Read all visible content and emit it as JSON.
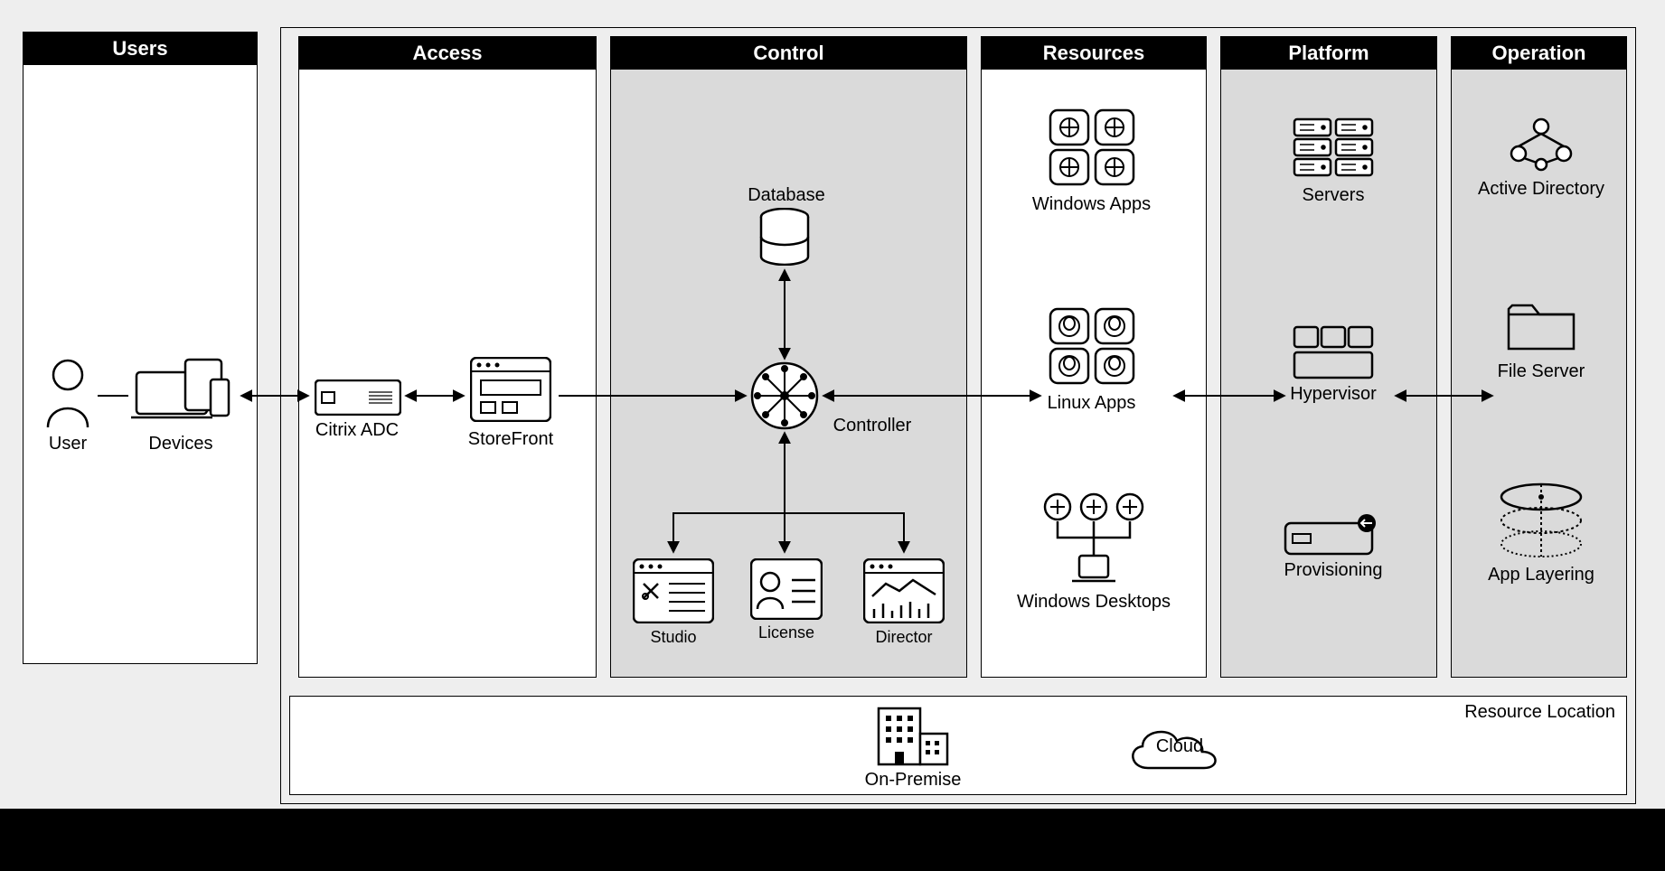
{
  "layers": {
    "users": "Users",
    "access": "Access",
    "control": "Control",
    "resources": "Resources",
    "platform": "Platform",
    "operation": "Operation"
  },
  "nodes": {
    "user": "User",
    "devices": "Devices",
    "citrix_adc": "Citrix ADC",
    "storefront": "StoreFront",
    "database": "Database",
    "controller": "Controller",
    "studio": "Studio",
    "license": "License",
    "director": "Director",
    "windows_apps": "Windows Apps",
    "linux_apps": "Linux Apps",
    "windows_desktops": "Windows Desktops",
    "servers": "Servers",
    "hypervisor": "Hypervisor",
    "provisioning": "Provisioning",
    "active_directory": "Active Directory",
    "file_server": "File Server",
    "app_layering": "App Layering"
  },
  "footer": {
    "title": "Resource Location",
    "on_premise": "On-Premise",
    "cloud": "Cloud"
  }
}
